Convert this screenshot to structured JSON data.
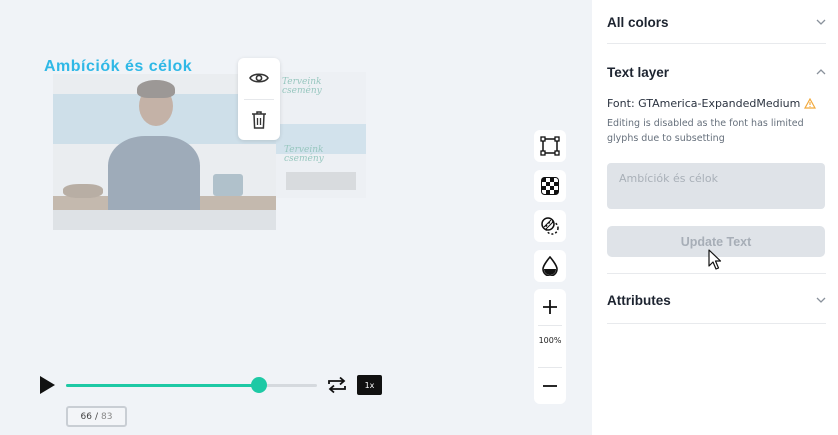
{
  "canvas": {
    "scene_title": "Ambíciók és célok",
    "frame_text_top": "Terveink\ncsemény",
    "frame_text_bottom": "Terveink\ncsemény"
  },
  "layer_actions": {
    "visibility_icon": "eye-icon",
    "delete_icon": "trash-icon"
  },
  "tools": {
    "transform_icon": "transform-icon",
    "transparency_icon": "checkerboard-icon",
    "blend_icon": "blend-mode-icon",
    "fill_icon": "drop-icon",
    "zoom_in_icon": "plus-icon",
    "zoom_level": "100%",
    "zoom_out_icon": "minus-icon"
  },
  "playback": {
    "play_icon": "play-icon",
    "progress_fraction": 0.77,
    "loop_icon": "repeat-icon",
    "speed": "1x",
    "current_frame": "66",
    "separator": "/",
    "total_frames": "83",
    "accent_color": "#1ec9a5"
  },
  "panel": {
    "all_colors": "All colors",
    "text_layer": "Text layer",
    "font_label": "Font: GTAmerica-ExpandedMedium",
    "warning_icon": "warning-icon",
    "font_warning": "Editing is disabled as the font has limited glyphs due to subsetting",
    "text_input_value": "Ambíciók és célok",
    "update_button": "Update Text",
    "attributes": "Attributes",
    "warning_color": "#f2a93b"
  }
}
